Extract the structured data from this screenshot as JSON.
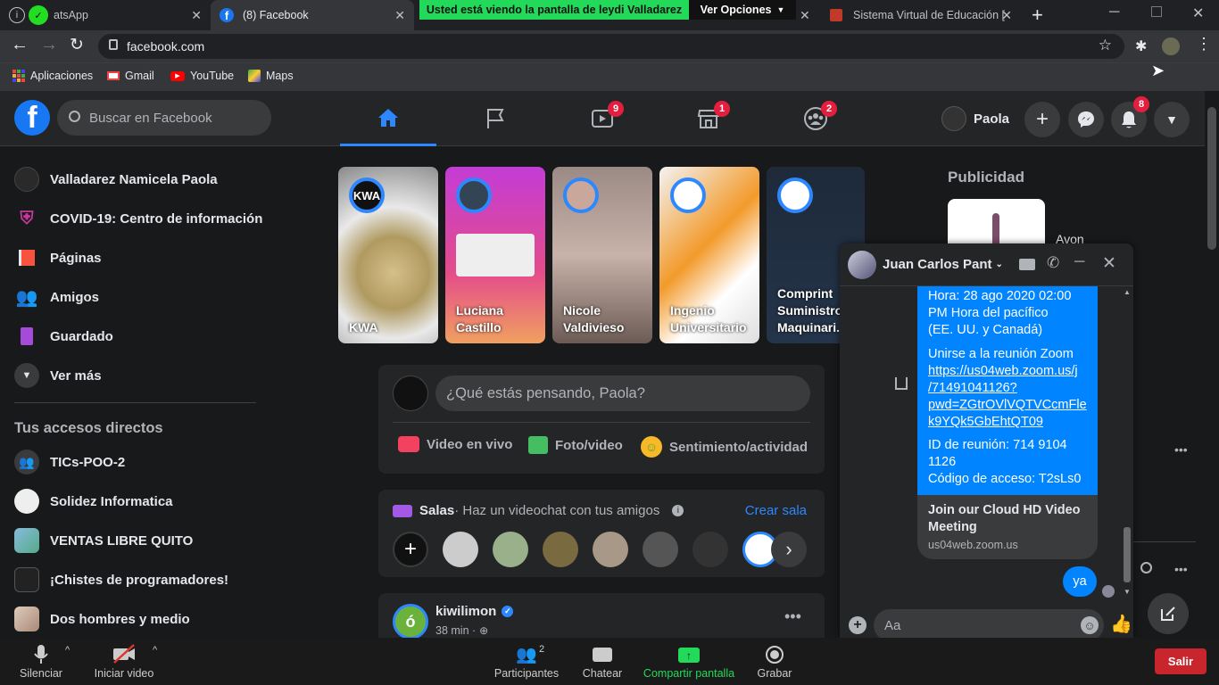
{
  "browser": {
    "tabs": [
      {
        "title": "atsApp"
      },
      {
        "title": "(8) Facebook"
      },
      {
        "title": "Sistema Virtual de Educación ["
      }
    ],
    "share_banner": "Usted está viendo la pantalla de leydi Valladarez",
    "view_options": "Ver Opciones",
    "url": "facebook.com",
    "bookmarks": [
      "Aplicaciones",
      "Gmail",
      "YouTube",
      "Maps"
    ]
  },
  "header": {
    "search_placeholder": "Buscar en Facebook",
    "badges": {
      "watch": "9",
      "marketplace": "1",
      "groups": "2",
      "notifications": "8"
    },
    "profile_name": "Paola"
  },
  "sidebar": {
    "items": [
      {
        "label": "Valladarez Namicela Paola"
      },
      {
        "label": "COVID-19: Centro de información"
      },
      {
        "label": "Páginas"
      },
      {
        "label": "Amigos"
      },
      {
        "label": "Guardado"
      },
      {
        "label": "Ver más"
      }
    ],
    "shortcuts_title": "Tus accesos directos",
    "shortcuts": [
      {
        "label": "TICs-POO-2"
      },
      {
        "label": "Solidez Informatica"
      },
      {
        "label": "VENTAS LIBRE QUITO"
      },
      {
        "label": "¡Chistes de programadores!"
      },
      {
        "label": "Dos hombres y medio"
      }
    ]
  },
  "stories": [
    {
      "name": "KWA"
    },
    {
      "name": "Luciana Castillo"
    },
    {
      "name": "Nicole Valdivieso"
    },
    {
      "name": "Ingenio Universitario"
    },
    {
      "name": "Comprint Suministro Maquinari..."
    }
  ],
  "composer": {
    "placeholder": "¿Qué estás pensando, Paola?",
    "live": "Video en vivo",
    "photo": "Foto/video",
    "feeling": "Sentimiento/actividad"
  },
  "rooms": {
    "title": "Salas",
    "subtitle": " · Haz un videochat con tus amigos",
    "create": "Crear sala"
  },
  "post": {
    "author": "kiwilimon",
    "time": "38 min ·"
  },
  "right": {
    "sponsored": "Publicidad",
    "ad_name": "Avon"
  },
  "chat": {
    "contact": "Juan Carlos Pant",
    "message_lines": [
      "Hora: 28 ago 2020 02:00",
      "PM Hora del pacífico",
      "(EE. UU. y Canadá)"
    ],
    "join_label": "Unirse a la reunión Zoom",
    "link_lines": [
      "https://us04web.zoom.us/j",
      "/71491041126?",
      "pwd=ZGtrOVlVQTVCcmFle",
      "k9YQk5GbEhtQT09"
    ],
    "id_lines": [
      "ID de reunión: 714 9104",
      "1126",
      "Código de acceso: T2sLs0"
    ],
    "preview_title": "Join our Cloud HD Video Meeting",
    "preview_domain": "us04web.zoom.us",
    "reply": "ya",
    "input_placeholder": "Aa"
  },
  "zoom": {
    "mute": "Silenciar",
    "video": "Iniciar video",
    "participants": "Participantes",
    "participants_count": "2",
    "chat": "Chatear",
    "share": "Compartir pantalla",
    "record": "Grabar",
    "exit": "Salir"
  },
  "colors": {
    "fb_blue": "#1877f2",
    "bg": "#18191a",
    "card": "#242526",
    "zoom_green": "#23d959",
    "badge": "#e41e3f"
  }
}
